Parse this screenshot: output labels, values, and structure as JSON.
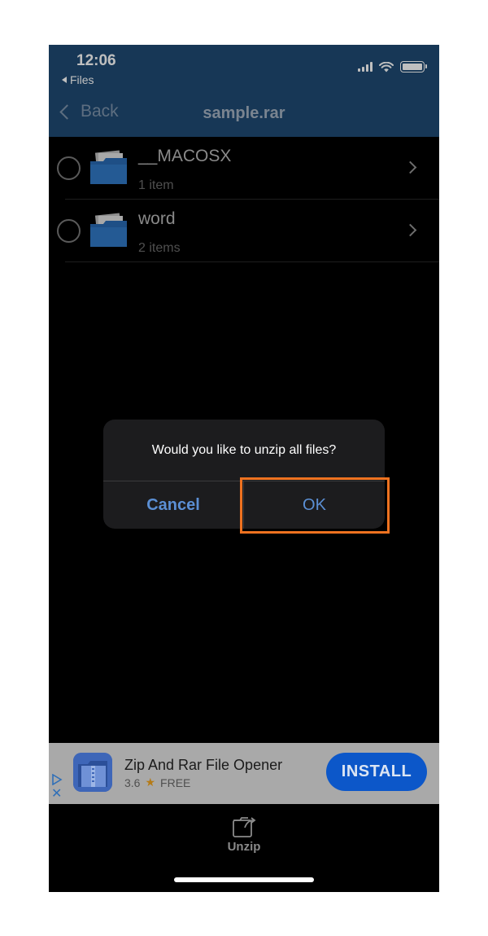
{
  "status_bar": {
    "time": "12:06",
    "back_app_label": "Files"
  },
  "nav": {
    "back_label": "Back",
    "title": "sample.rar"
  },
  "file_list": [
    {
      "name": "__MACOSX",
      "subtitle": "1 item"
    },
    {
      "name": "word",
      "subtitle": "2 items"
    }
  ],
  "dialog": {
    "message": "Would you like to unzip all files?",
    "cancel_label": "Cancel",
    "ok_label": "OK",
    "highlight_color": "#ee7220"
  },
  "ad": {
    "app_name": "Zip And Rar File Opener",
    "rating": "3.6",
    "price": "FREE",
    "install_label": "INSTALL"
  },
  "toolbar": {
    "unzip_label": "Unzip"
  },
  "colors": {
    "header_bg": "#1f4a73",
    "accent_blue": "#5b8fd4",
    "install_button": "#0c57c9"
  }
}
